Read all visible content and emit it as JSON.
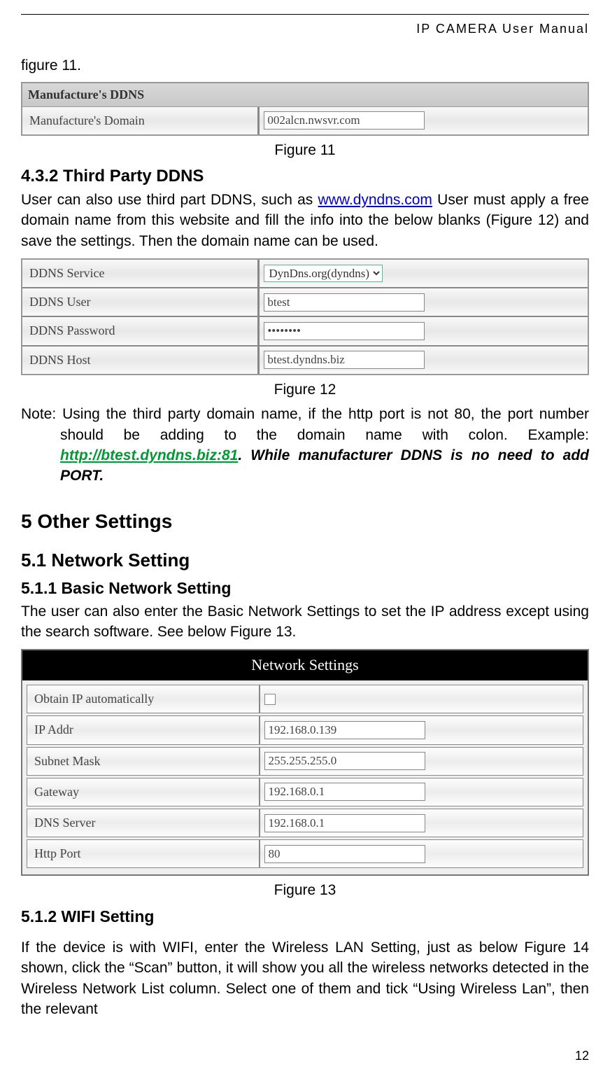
{
  "header": "IP CAMERA User Manual",
  "pageNumber": "12",
  "figRef11": "figure 11.",
  "fig11": {
    "title": "Manufacture's DDNS",
    "rows": [
      {
        "label": "Manufacture's Domain",
        "value": "002alcn.nwsvr.com"
      }
    ],
    "caption": "Figure 11"
  },
  "section432": {
    "heading": "4.3.2  Third Party DDNS",
    "para_pre": "User can also use third part DDNS, such as ",
    "link1": "www.dyndns.com",
    "para_post": " User must apply a free domain name from this website and fill the info into the below blanks (Figure 12) and save the settings. Then the domain name can be used."
  },
  "fig12": {
    "rows": [
      {
        "label": "DDNS Service",
        "type": "select",
        "value": "DynDns.org(dyndns)"
      },
      {
        "label": "DDNS User",
        "type": "text",
        "value": "btest"
      },
      {
        "label": "DDNS Password",
        "type": "password",
        "value": "••••••••"
      },
      {
        "label": "DDNS Host",
        "type": "text",
        "value": "btest.dyndns.biz"
      }
    ],
    "caption": "Figure 12"
  },
  "note": {
    "prefix": "Note: ",
    "text1": "Using the third party domain name, if the http port is not 80, the port number should be adding to the domain name with colon. Example: ",
    "link": "http://btest.dyndns.biz:81",
    "period": ".",
    "text2": " While manufacturer DDNS is no need to add PORT."
  },
  "h5": "5  Other Settings",
  "h51": "5.1  Network Setting",
  "h511": "5.1.1  Basic Network Setting",
  "para511": "The user can also enter the Basic Network Settings to set the IP address except using the search software. See below Figure 13.",
  "fig13": {
    "title": "Network Settings",
    "rows": [
      {
        "label": "Obtain IP automatically",
        "type": "checkbox",
        "value": ""
      },
      {
        "label": "IP Addr",
        "type": "text",
        "value": "192.168.0.139"
      },
      {
        "label": "Subnet Mask",
        "type": "text",
        "value": "255.255.255.0"
      },
      {
        "label": "Gateway",
        "type": "text",
        "value": "192.168.0.1"
      },
      {
        "label": "DNS Server",
        "type": "text",
        "value": "192.168.0.1"
      },
      {
        "label": "Http Port",
        "type": "text",
        "value": "80"
      }
    ],
    "caption": "Figure 13"
  },
  "h512": "5.1.2  WIFI Setting",
  "para512": "If the device is with WIFI, enter the Wireless LAN Setting, just as below Figure 14 shown, click the “Scan” button, it will show you all the wireless networks detected in the Wireless Network List column. Select one of them and tick “Using Wireless Lan”, then the relevant"
}
